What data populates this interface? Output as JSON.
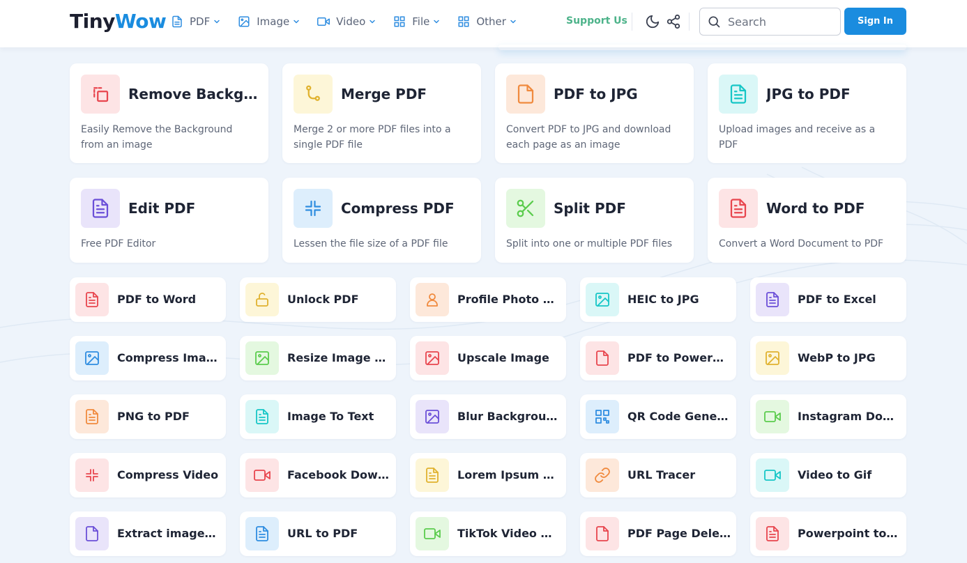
{
  "header": {
    "logo_part1": "Tiny",
    "logo_part2": "Wow",
    "nav": [
      {
        "label": "PDF",
        "icon": "file-text-icon"
      },
      {
        "label": "Image",
        "icon": "image-icon"
      },
      {
        "label": "Video",
        "icon": "video-icon"
      },
      {
        "label": "File",
        "icon": "grid-icon"
      },
      {
        "label": "Other",
        "icon": "grid-icon"
      }
    ],
    "support_label": "Support Us",
    "search_placeholder": "Search",
    "signin_label": "Sign In"
  },
  "colors": {
    "brand_blue": "#1a8cdf",
    "support_green": "#4db38a"
  },
  "featured_tools": [
    {
      "title": "Remove Background",
      "desc": "Easily Remove the Background from an image",
      "icon": "crop-icon",
      "color": "#e8454e",
      "bg": "#fde4e5"
    },
    {
      "title": "Merge PDF",
      "desc": "Merge 2 or more PDF files into a single PDF file",
      "icon": "merge-icon",
      "color": "#e0b22f",
      "bg": "#fdf6d8"
    },
    {
      "title": "PDF to JPG",
      "desc": "Convert PDF to JPG and download each page as an image",
      "icon": "file-icon",
      "color": "#f08a3e",
      "bg": "#fde8da"
    },
    {
      "title": "JPG to PDF",
      "desc": "Upload images and receive as a PDF",
      "icon": "file-text-icon",
      "color": "#16c6c6",
      "bg": "#daf7f7"
    },
    {
      "title": "Edit PDF",
      "desc": "Free PDF Editor",
      "icon": "file-text-icon",
      "color": "#6b4fd8",
      "bg": "#e9e4fa"
    },
    {
      "title": "Compress PDF",
      "desc": "Lessen the file size of a PDF file",
      "icon": "compress-icon",
      "color": "#2f8de0",
      "bg": "#ddeefc"
    },
    {
      "title": "Split PDF",
      "desc": "Split into one or multiple PDF files",
      "icon": "scissors-icon",
      "color": "#5bcc4d",
      "bg": "#e4f8e0"
    },
    {
      "title": "Word to PDF",
      "desc": "Convert a Word Document to PDF",
      "icon": "file-text-icon",
      "color": "#e8454e",
      "bg": "#fde4e5"
    }
  ],
  "tools": [
    {
      "title": "PDF to Word",
      "icon": "file-text-icon",
      "color": "#e8454e",
      "bg": "#fde4e5"
    },
    {
      "title": "Unlock PDF",
      "icon": "unlock-icon",
      "color": "#e0b22f",
      "bg": "#fdf6d8"
    },
    {
      "title": "Profile Photo Maker",
      "icon": "user-icon",
      "color": "#f08a3e",
      "bg": "#fde8da"
    },
    {
      "title": "HEIC to JPG",
      "icon": "image-icon",
      "color": "#16c6c6",
      "bg": "#daf7f7"
    },
    {
      "title": "PDF to Excel",
      "icon": "file-text-icon",
      "color": "#6b4fd8",
      "bg": "#e9e4fa"
    },
    {
      "title": "Compress Image",
      "icon": "image-icon",
      "color": "#2f8de0",
      "bg": "#ddeefc"
    },
    {
      "title": "Resize Image Dimensions",
      "icon": "image-icon",
      "color": "#5bcc4d",
      "bg": "#e4f8e0"
    },
    {
      "title": "Upscale Image",
      "icon": "image-icon",
      "color": "#e8454e",
      "bg": "#fde4e5"
    },
    {
      "title": "PDF to Powerpoint",
      "icon": "file-icon",
      "color": "#e8454e",
      "bg": "#fde4e5"
    },
    {
      "title": "WebP to JPG",
      "icon": "image-icon",
      "color": "#e0b22f",
      "bg": "#fdf6d8"
    },
    {
      "title": "PNG to PDF",
      "icon": "file-text-icon",
      "color": "#f08a3e",
      "bg": "#fde8da"
    },
    {
      "title": "Image To Text",
      "icon": "file-text-icon",
      "color": "#16c6c6",
      "bg": "#daf7f7"
    },
    {
      "title": "Blur Background Image",
      "icon": "image-icon",
      "color": "#6b4fd8",
      "bg": "#e9e4fa"
    },
    {
      "title": "QR Code Generator",
      "icon": "qr-icon",
      "color": "#2f8de0",
      "bg": "#ddeefc"
    },
    {
      "title": "Instagram Downloader",
      "icon": "video-icon",
      "color": "#5bcc4d",
      "bg": "#e4f8e0"
    },
    {
      "title": "Compress Video",
      "icon": "compress-icon",
      "color": "#e8454e",
      "bg": "#fde4e5"
    },
    {
      "title": "Facebook Downloader",
      "icon": "video-icon",
      "color": "#e8454e",
      "bg": "#fde4e5"
    },
    {
      "title": "Lorem Ipsum Generator",
      "icon": "file-text-icon",
      "color": "#e0b22f",
      "bg": "#fdf6d8"
    },
    {
      "title": "URL Tracer",
      "icon": "link-icon",
      "color": "#f08a3e",
      "bg": "#fde8da"
    },
    {
      "title": "Video to Gif",
      "icon": "video-icon",
      "color": "#16c6c6",
      "bg": "#daf7f7"
    },
    {
      "title": "Extract images PDF",
      "icon": "file-icon",
      "color": "#6b4fd8",
      "bg": "#e9e4fa"
    },
    {
      "title": "URL to PDF",
      "icon": "file-text-icon",
      "color": "#2f8de0",
      "bg": "#ddeefc"
    },
    {
      "title": "TikTok Video Downloader",
      "icon": "video-icon",
      "color": "#5bcc4d",
      "bg": "#e4f8e0"
    },
    {
      "title": "PDF Page Deleter",
      "icon": "file-icon",
      "color": "#e8454e",
      "bg": "#fde4e5"
    },
    {
      "title": "Powerpoint to PDF",
      "icon": "file-text-icon",
      "color": "#e8454e",
      "bg": "#fde4e5"
    }
  ]
}
